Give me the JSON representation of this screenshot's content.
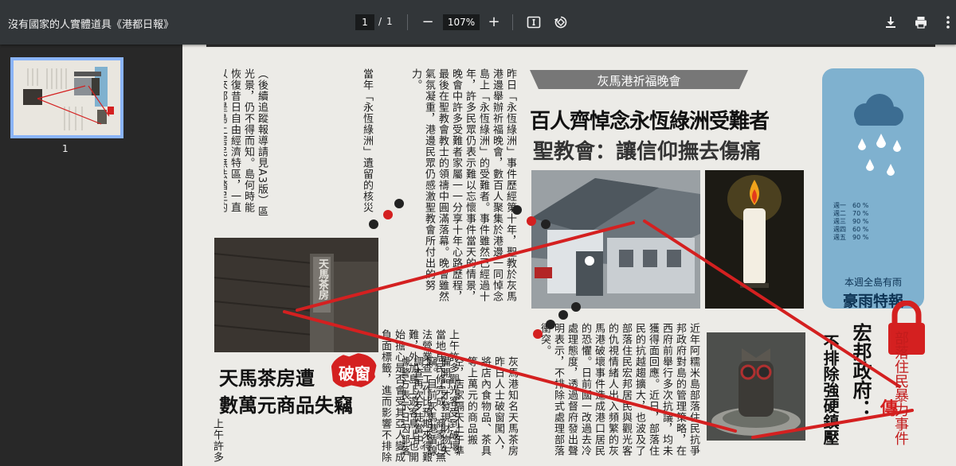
{
  "toolbar": {
    "title": "沒有國家的人實體道具《港都日報》",
    "page_current": "1",
    "page_separator": "/",
    "page_total": "1",
    "zoom_out": "−",
    "zoom": "107%",
    "zoom_in": "+"
  },
  "sidebar": {
    "thumbnail_label": "1"
  },
  "newspaper": {
    "col_a": "（後續追蹤報導請見A3版）區光景，仍不得而知。島何時能恢復昔日自由經濟特區，一直以來都是島上居民無法踏足的禁地，也直接導致了阿糯米島沒落。事發至今，除聖教會對人心的安撫，伊肖公約組織仍持續派駐人員於核災區進行環境修復，只是阿糯米",
    "col_a_head": "當年「永恆綠洲」遺留的核災",
    "col_b": "昨日「永恆綠洲」事件歷經第十年，聖教於灰馬港邊舉辦祈福晚會，數百人聚集於港邊一同悼念島上「永恆綠洲」的受難者。事件雖然已經過十年，許多民眾仍表示難以忘懷事件當天的情景，晚會中許多受難者家屬一一分享十年心路歷程，最後在聖教會教士的領禱中圓滿落幕。晚會雖然氣氛凝重，港邊民眾仍感激聖教會所付出的努力。",
    "kicker": "灰馬港祈福晚會",
    "headline1": "百人齊悼念永恆綠洲受難者",
    "headline2": "聖教會：讓信仰撫去傷痛",
    "headline3a": "天馬茶房遭",
    "headline3_badge": "破窗",
    "headline3b": "數萬元商品失竊",
    "col_c": "灰馬港知名天馬茶房昨日人士破窗闖入，將店內食物品、茶具等上萬元的商品搬空，店家隔天上午準備開門才發現財物失竊。目前灰馬港循線調查再次歹徒當中。據警方表示日因部落阿糯米人暴力抗爭",
    "col_d": "上午許多觀光客受到破壞，當地居民修完成，商家也無法營業查工作比預期來得艱難，外加島上遊客鳥上也開始擔心是否會受其亞人變成負面標籤，進而影響不排除是島上其他別有心人或是居心叵測的部落所犯下的罪行。事端，阿糯米人為了表達",
    "col_e": "近年阿糯米島部落住民抗爭邦政府對島的管理策略，在西府前舉行多次抗議，均未獲得面回應。近日，部落住民的抗越趨擴大，也波及了部落住民宏邦居民與觀光客的仇視情緒人出入頻繁的灰馬港破壞事件造成港口居民的恐懼。日前國一改過去冷處理態度，透過督府發出聲明表示，不排除式處理部落衝突。",
    "headline4a": "宏邦政府：",
    "headline4b": "不排除強硬鎮壓",
    "stamp_text": "部落住民暴力事件",
    "stamp_mark": "傳",
    "weather": {
      "rows": [
        "週一　60 %",
        "週二　70 %",
        "週三　90 %",
        "週四　60 %",
        "週五　90 %"
      ],
      "subtitle": "本週全島有雨",
      "title": "豪雨特報"
    },
    "sign_text": "天馬茶房"
  },
  "colors": {
    "accent_red": "#d42020",
    "weather_bg": "#7fb1cf",
    "toolbar_bg": "#323639"
  }
}
